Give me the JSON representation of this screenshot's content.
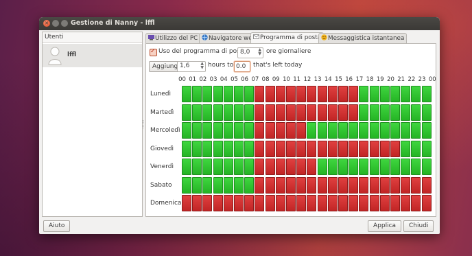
{
  "window": {
    "title": "Gestione di Nanny - lffl"
  },
  "sidebar": {
    "header": "Utenti",
    "users": [
      {
        "name": "lffl"
      }
    ]
  },
  "tabs": [
    {
      "label": "Utilizzo del PC",
      "icon": "pc-usage-icon"
    },
    {
      "label": "Navigatore web",
      "icon": "web-browser-icon"
    },
    {
      "label": "Programma di posta",
      "icon": "mail-icon",
      "active": true
    },
    {
      "label": "Messaggistica istantanea",
      "icon": "chat-smiley-icon"
    }
  ],
  "controls": {
    "use_label": "Uso del programma di posta",
    "use_checked": true,
    "daily_hours_value": "8,0",
    "daily_hours_suffix": "ore giornaliere",
    "add_button": "Aggiungi",
    "add_hours_value": "1,6",
    "hours_to_label": "hours to",
    "left_value": "0.0",
    "left_suffix": "that's left today"
  },
  "schedule": {
    "hours": [
      "00",
      "01",
      "02",
      "03",
      "04",
      "05",
      "06",
      "07",
      "08",
      "09",
      "10",
      "11",
      "12",
      "13",
      "14",
      "15",
      "16",
      "17",
      "18",
      "19",
      "20",
      "21",
      "22",
      "23",
      "00"
    ],
    "days": [
      {
        "name": "Lunedì",
        "allowed": [
          1,
          1,
          1,
          1,
          1,
          1,
          1,
          0,
          0,
          0,
          0,
          0,
          0,
          0,
          0,
          0,
          0,
          1,
          1,
          1,
          1,
          1,
          1,
          1
        ]
      },
      {
        "name": "Martedì",
        "allowed": [
          1,
          1,
          1,
          1,
          1,
          1,
          1,
          0,
          0,
          0,
          0,
          0,
          0,
          0,
          0,
          0,
          0,
          1,
          1,
          1,
          1,
          1,
          1,
          1
        ]
      },
      {
        "name": "Mercoledì",
        "allowed": [
          1,
          1,
          1,
          1,
          1,
          1,
          1,
          0,
          0,
          0,
          0,
          0,
          1,
          1,
          1,
          1,
          1,
          1,
          1,
          1,
          1,
          1,
          1,
          1
        ]
      },
      {
        "name": "Giovedì",
        "allowed": [
          1,
          1,
          1,
          1,
          1,
          1,
          1,
          0,
          0,
          0,
          0,
          0,
          0,
          0,
          0,
          0,
          0,
          0,
          0,
          0,
          0,
          1,
          1,
          1
        ]
      },
      {
        "name": "Venerdì",
        "allowed": [
          1,
          1,
          1,
          1,
          1,
          1,
          1,
          0,
          0,
          0,
          0,
          0,
          0,
          1,
          1,
          1,
          1,
          1,
          1,
          1,
          1,
          1,
          1,
          1
        ]
      },
      {
        "name": "Sabato",
        "allowed": [
          1,
          1,
          1,
          1,
          1,
          1,
          1,
          0,
          0,
          0,
          0,
          0,
          0,
          0,
          0,
          0,
          0,
          0,
          0,
          0,
          0,
          0,
          0,
          0
        ]
      },
      {
        "name": "Domenica",
        "allowed": [
          0,
          0,
          0,
          0,
          0,
          0,
          0,
          0,
          0,
          0,
          0,
          0,
          0,
          0,
          0,
          0,
          0,
          0,
          0,
          0,
          0,
          0,
          0,
          0
        ]
      }
    ]
  },
  "footer": {
    "help_button": "Aiuto",
    "apply_button": "Applica",
    "close_button": "Chiudi"
  },
  "colors": {
    "allowed": "#2ec42e",
    "blocked": "#d22f2f"
  }
}
